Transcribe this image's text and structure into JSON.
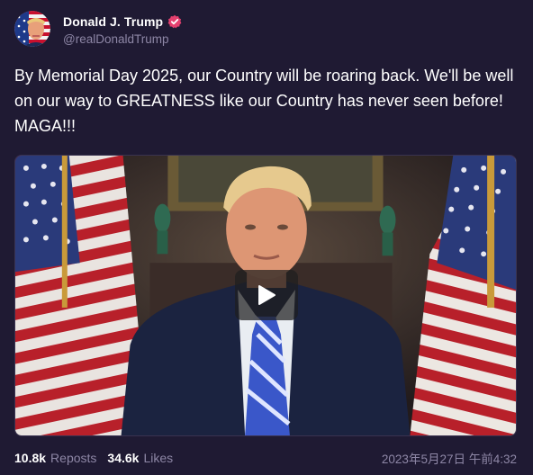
{
  "post": {
    "author": {
      "display_name": "Donald J. Trump",
      "handle": "@realDonaldTrump",
      "verified_icon": "verified-badge-icon",
      "avatar_icon": "avatar"
    },
    "text": "By Memorial Day 2025, our Country will be roaring back. We'll be well on our way to GREATNESS like our Country has never seen before! MAGA!!!",
    "media": {
      "type": "video",
      "play_icon": "play-icon"
    },
    "stats": {
      "reposts_count": "10.8k",
      "reposts_label": "Reposts",
      "likes_count": "34.6k",
      "likes_label": "Likes"
    },
    "timestamp": "2023年5月27日 午前4:32"
  },
  "colors": {
    "background": "#1f1a33",
    "muted_text": "#8e87a6",
    "verified_badge": "#e4406f"
  }
}
